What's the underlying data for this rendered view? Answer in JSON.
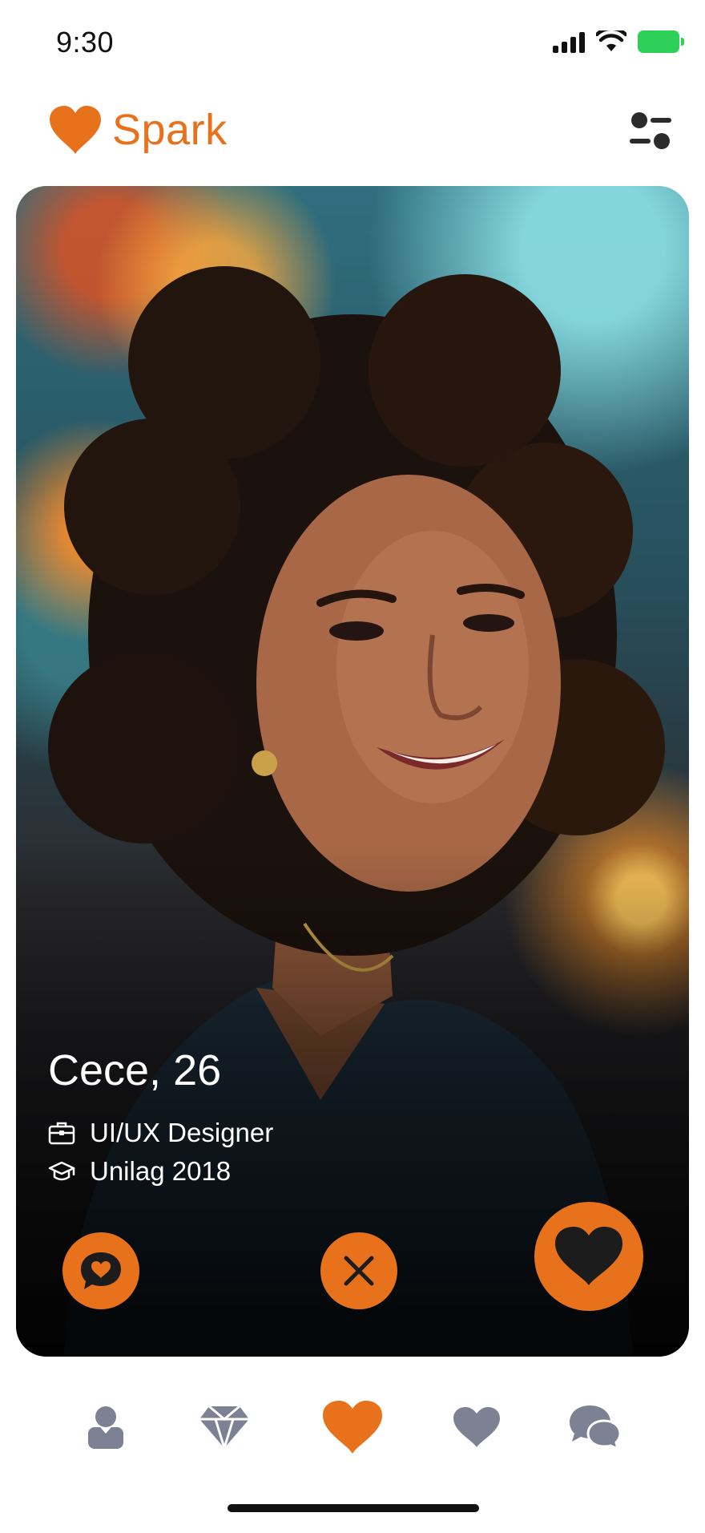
{
  "status_bar": {
    "time": "9:30",
    "icons": [
      "cellular-signal-icon",
      "wifi-icon",
      "battery-icon"
    ],
    "battery_color": "#2ed158"
  },
  "header": {
    "app_name": "Spark",
    "logo_icon": "heart-icon",
    "filter_icon": "filter-toggles-icon",
    "brand_color": "#e8711c"
  },
  "profile_card": {
    "name_age": "Cece, 26",
    "job": "UI/UX Designer",
    "job_icon": "briefcase-icon",
    "education": "Unilag 2018",
    "education_icon": "graduation-cap-icon",
    "actions": [
      {
        "name": "message",
        "icon": "heart-chat-icon"
      },
      {
        "name": "pass",
        "icon": "close-icon"
      },
      {
        "name": "like",
        "icon": "heart-icon"
      }
    ]
  },
  "bottom_nav": {
    "items": [
      {
        "name": "profile",
        "icon": "user-icon",
        "active": false
      },
      {
        "name": "explore",
        "icon": "diamond-icon",
        "active": false
      },
      {
        "name": "spark",
        "icon": "heart-icon",
        "active": true
      },
      {
        "name": "likes",
        "icon": "heart-icon",
        "active": false
      },
      {
        "name": "messages",
        "icon": "chat-bubbles-icon",
        "active": false
      }
    ],
    "active_color": "#e8711c",
    "inactive_color": "#7c8293"
  }
}
